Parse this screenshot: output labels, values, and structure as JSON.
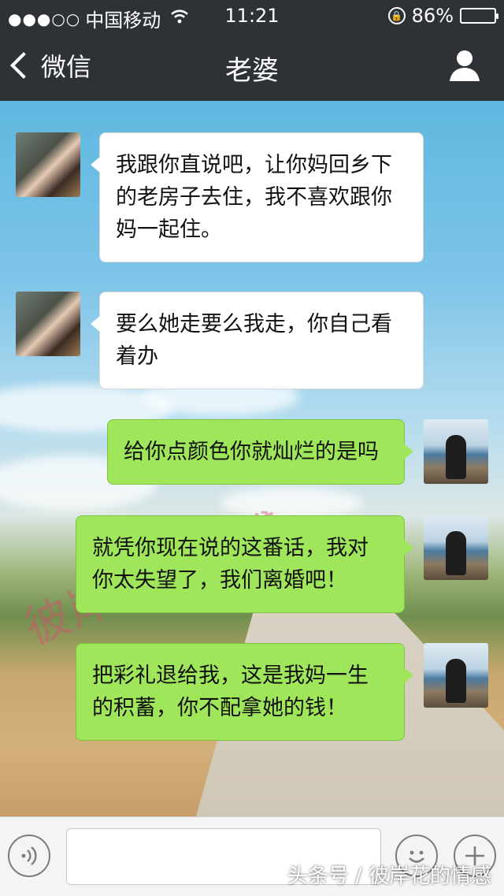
{
  "status_bar": {
    "signal_dots": "●●●○○",
    "carrier": "中国移动",
    "time": "11:21",
    "battery_percent": "86%",
    "battery_level": 0.86
  },
  "nav": {
    "back_label": "微信",
    "title": "老婆"
  },
  "messages": [
    {
      "side": "left",
      "text": "我跟你直说吧，让你妈回乡下的老房子去住，我不喜欢跟你妈一起住。"
    },
    {
      "side": "left",
      "text": "要么她走要么我走，你自己看着办"
    },
    {
      "side": "right",
      "text": "给你点颜色你就灿烂的是吗"
    },
    {
      "side": "right",
      "text": "就凭你现在说的这番话，我对你太失望了，我们离婚吧！"
    },
    {
      "side": "right",
      "text": "把彩礼退给我，这是我妈一生的积蓄，你不配拿她的钱！"
    }
  ],
  "watermarks": {
    "diagonal": "彼岸花的情感",
    "footer": "头条号 / 彼岸花的情感"
  },
  "colors": {
    "header_bg": "#2e3236",
    "bubble_out": "#9fe65a",
    "bubble_in": "#ffffff"
  },
  "icons": {
    "wifi": "wifi-icon",
    "lock": "rotation-lock-icon",
    "profile": "person-icon",
    "voice": "voice-icon",
    "emoji": "emoji-icon",
    "plus": "plus-icon"
  }
}
